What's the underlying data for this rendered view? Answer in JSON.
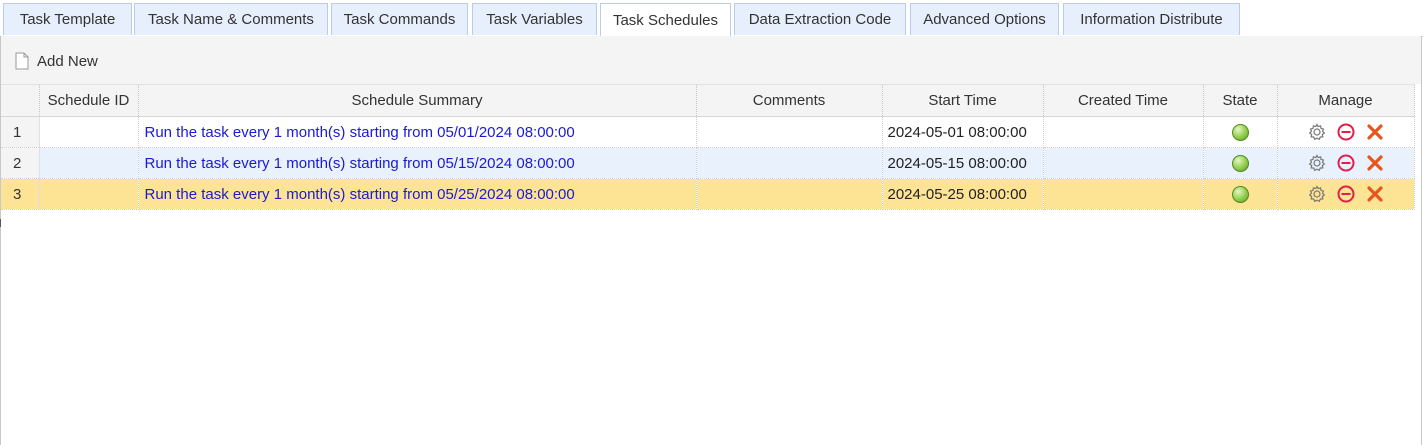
{
  "tabs": [
    {
      "label": "Task Template",
      "active": false
    },
    {
      "label": "Task Name & Comments",
      "active": false
    },
    {
      "label": "Task Commands",
      "active": false
    },
    {
      "label": "Task Variables",
      "active": false
    },
    {
      "label": "Task Schedules",
      "active": true
    },
    {
      "label": "Data Extraction Code",
      "active": false
    },
    {
      "label": "Advanced Options",
      "active": false
    },
    {
      "label": "Information Distribute",
      "active": false
    }
  ],
  "toolbar": {
    "add_new_label": "Add New",
    "add_new_icon": "document-icon"
  },
  "grid": {
    "columns": [
      "",
      "Schedule ID",
      "Schedule Summary",
      "Comments",
      "Start Time",
      "Created Time",
      "State",
      "Manage"
    ],
    "rows": [
      {
        "num": "1",
        "schedule_id": "",
        "summary": "Run the task every 1 month(s) starting from 05/01/2024 08:00:00",
        "comments": "",
        "start_time": "2024-05-01 08:00:00",
        "created_time": "",
        "state": "active"
      },
      {
        "num": "2",
        "schedule_id": "",
        "summary": "Run the task every 1 month(s) starting from 05/15/2024 08:00:00",
        "comments": "",
        "start_time": "2024-05-15 08:00:00",
        "created_time": "",
        "state": "active"
      },
      {
        "num": "3",
        "schedule_id": "",
        "summary": "Run the task every 1 month(s) starting from 05/25/2024 08:00:00",
        "comments": "",
        "start_time": "2024-05-25 08:00:00",
        "created_time": "",
        "state": "active"
      }
    ],
    "manage_icons": [
      "gear-icon",
      "disable-icon",
      "delete-icon"
    ]
  },
  "colors": {
    "tab_bg": "#e6effb",
    "tab_border": "#b9cde5",
    "link_text": "#1a1ad6",
    "row_alt": "#e9f1fd",
    "row_selected": "#fde495",
    "state_green": "#9fd55a",
    "disable_red": "#e0204a",
    "delete_orange": "#e8541c"
  }
}
